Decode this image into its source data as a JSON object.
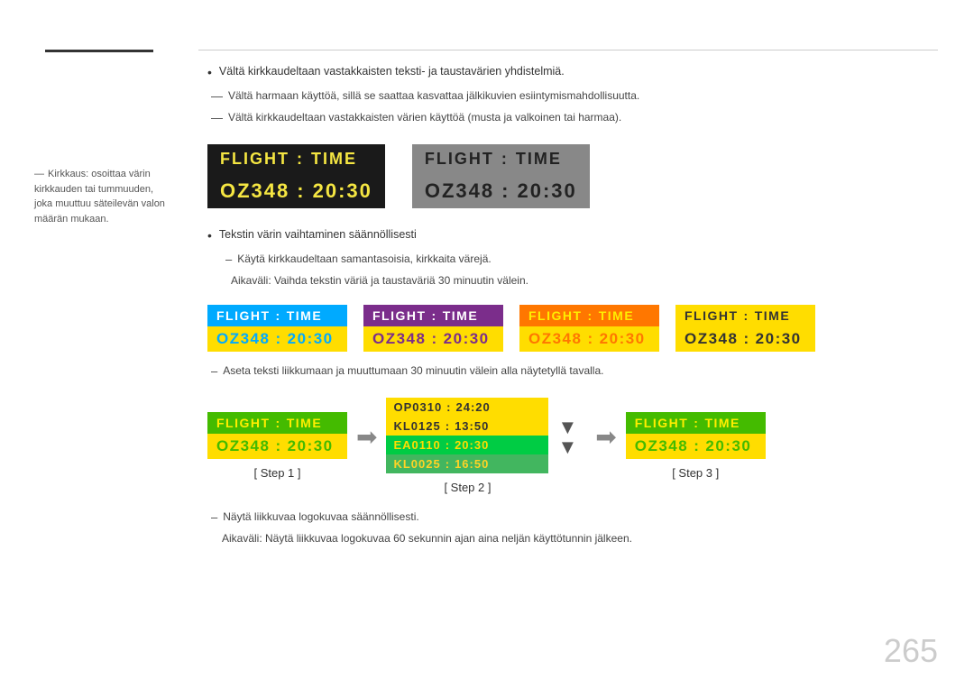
{
  "page": {
    "number": "265"
  },
  "sidebar": {
    "note": "Kirkkaus: osoittaa värin kirkkauden tai tummuuden, joka muuttuu säteilevän valon määrän mukaan."
  },
  "bullets": {
    "item1": "Vältä kirkkaudeltaan vastakkaisten teksti- ja taustavärien yhdistelmiä.",
    "item2": "Vältä harmaan käyttöä, sillä se saattaa kasvattaa jälkikuvien esiintymismahdollisuutta.",
    "item3": "Vältä kirkkaudeltaan vastakkaisten värien käyttöä (musta ja valkoinen tai harmaa).",
    "item4": "Tekstin värin vaihtaminen säännöllisesti",
    "dash1": "Käytä kirkkaudeltaan samantasoisia, kirkkaita värejä.",
    "dash2": "Aikaväli: Vaihda tekstin väriä ja taustaväriä 30 minuutin välein.",
    "item5_dash": "Aseta teksti liikkumaan ja muuttumaan 30 minuutin välein alla näytetyllä tavalla.",
    "footnote1": "Näytä liikkuvaa logokuvaa säännöllisesti.",
    "footnote2": "Aikaväli: Näytä liikkuvaa logokuvaa 60 sekunnin ajan aina neljän käyttötunnin jälkeen."
  },
  "boards": {
    "big1": {
      "label1": "FLIGHT",
      "colon1": ":",
      "label2": "TIME",
      "label3": "OZ348",
      "colon2": ":",
      "label4": "20:30"
    },
    "big2": {
      "label1": "FLIGHT",
      "colon1": ":",
      "label2": "TIME",
      "label3": "OZ348",
      "colon2": ":",
      "label4": "20:30"
    },
    "small1": {
      "label1": "FLIGHT",
      "colon1": ":",
      "label2": "TIME",
      "label3": "OZ348",
      "colon2": ":",
      "label4": "20:30"
    },
    "small2": {
      "label1": "FLIGHT",
      "colon1": ":",
      "label2": "TIME",
      "label3": "OZ348",
      "colon2": ":",
      "label4": "20:30"
    },
    "small3": {
      "label1": "FLIGHT",
      "colon1": ":",
      "label2": "TIME",
      "label3": "OZ348",
      "colon2": ":",
      "label4": "20:30"
    },
    "small4": {
      "label1": "FLIGHT",
      "colon1": ":",
      "label2": "TIME",
      "label3": "OZ348",
      "colon2": ":",
      "label4": "20:30"
    }
  },
  "steps": {
    "step1_label": "[ Step 1 ]",
    "step2_label": "[ Step 2 ]",
    "step3_label": "[ Step 3 ]",
    "step1_board": {
      "label1": "FLIGHT",
      "colon1": ":",
      "label2": "TIME",
      "label3": "OZ348",
      "colon2": ":",
      "label4": "20:30"
    },
    "step2_flights": [
      {
        "code": "OP0310",
        "colon": ":",
        "time": "24:20"
      },
      {
        "code": "KL0125",
        "colon": ":",
        "time": "13:50"
      },
      {
        "code": "EA0110",
        "colon": ":",
        "time": "20:30"
      },
      {
        "code": "KL0025",
        "colon": ":",
        "time": "16:50"
      }
    ],
    "step3_board": {
      "label1": "FLIGHT",
      "colon1": ":",
      "label2": "TIME",
      "label3": "OZ348",
      "colon2": ":",
      "label4": "20:30"
    }
  }
}
